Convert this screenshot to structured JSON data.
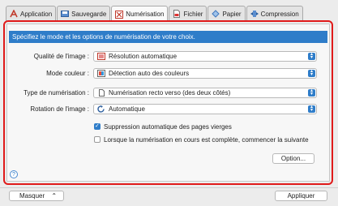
{
  "tabs": [
    {
      "label": "Application",
      "icon": "application-icon"
    },
    {
      "label": "Sauvegarde",
      "icon": "save-icon"
    },
    {
      "label": "Numérisation",
      "icon": "scan-icon",
      "active": true
    },
    {
      "label": "Fichier",
      "icon": "file-icon"
    },
    {
      "label": "Papier",
      "icon": "paper-icon"
    },
    {
      "label": "Compression",
      "icon": "compression-icon"
    }
  ],
  "banner": "Spécifiez le mode et les options de numérisation de votre choix.",
  "fields": {
    "quality": {
      "label": "Qualité de l'image :",
      "value": "Résolution automatique"
    },
    "color": {
      "label": "Mode couleur :",
      "value": "Détection auto des couleurs"
    },
    "scan_type": {
      "label": "Type de numérisation :",
      "value": "Numérisation recto verso (des deux côtés)"
    },
    "rotation": {
      "label": "Rotation de l'image :",
      "value": "Automatique"
    }
  },
  "checkboxes": {
    "blank_pages": {
      "label": "Suppression automatique des pages vierges",
      "checked": true
    },
    "continue_scan": {
      "label": "Lorsque la numérisation en cours est complète, commencer la suivante",
      "checked": false
    }
  },
  "buttons": {
    "option": "Option...",
    "help": "?",
    "hide": "Masquer",
    "apply": "Appliquer"
  },
  "colors": {
    "accent": "#2f7dc9",
    "highlight": "#e01a1a"
  }
}
